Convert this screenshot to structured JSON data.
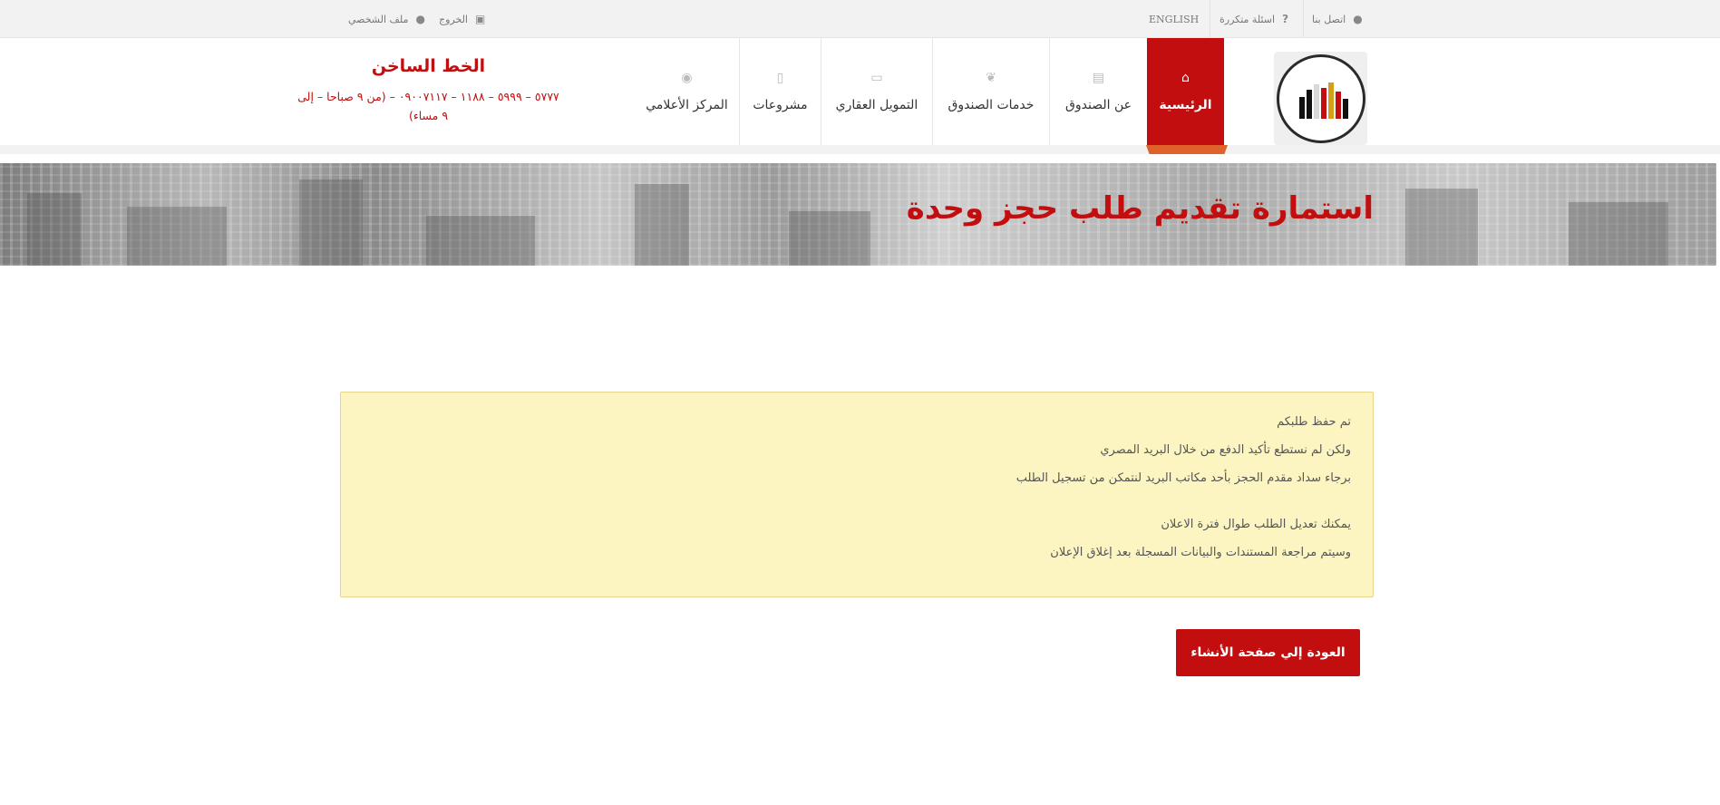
{
  "topbar": {
    "contact": "اتصل بنا",
    "faq": "اسئلة متكررة",
    "english": "ENGLISH",
    "logout": "الخروج",
    "profile": "ملف الشخصي"
  },
  "nav": {
    "items": [
      {
        "label": "الرئيسية",
        "icon": "home-icon",
        "active": true
      },
      {
        "label": "عن الصندوق",
        "icon": "archive-icon"
      },
      {
        "label": "خدمات الصندوق",
        "icon": "leaf-icon"
      },
      {
        "label": "التمويل العقاري",
        "icon": "money-icon"
      },
      {
        "label": "مشروعات",
        "icon": "building-icon"
      },
      {
        "label": "المركز الأعلامي",
        "icon": "eye-icon"
      }
    ]
  },
  "logo": {
    "alt": "Social Housing and Mortgage Finance Fund"
  },
  "hotline": {
    "title": "الخط الساخن",
    "text": "٥٧٧٧ – ٥٩٩٩ – ١١٨٨ – ٠٩٠٠٧١١٧ – (من ٩ صباحا – إلى ٩ مساء)"
  },
  "banner": {
    "title": "استمارة تقديم طلب حجز وحدة"
  },
  "alert": {
    "line1": "تم حفظ طلبكم",
    "line2": "ولكن لم نستطع تأكيد الدفع من خلال البريد المصري",
    "line3": "برجاء سداد مقدم الحجز بأحد مكاتب البريد لنتمكن من تسجيل الطلب",
    "line4": "يمكنك تعديل الطلب طوال فترة الاعلان",
    "line5": "وسيتم مراجعة المستندات والبيانات المسجلة بعد إغلاق الإعلان"
  },
  "actions": {
    "back": "العودة إلي صفحة الأنشاء"
  },
  "colors": {
    "brand_red": "#c20e0e",
    "alert_bg": "#fcf4c1",
    "topbar_bg": "#f2f2f2"
  }
}
